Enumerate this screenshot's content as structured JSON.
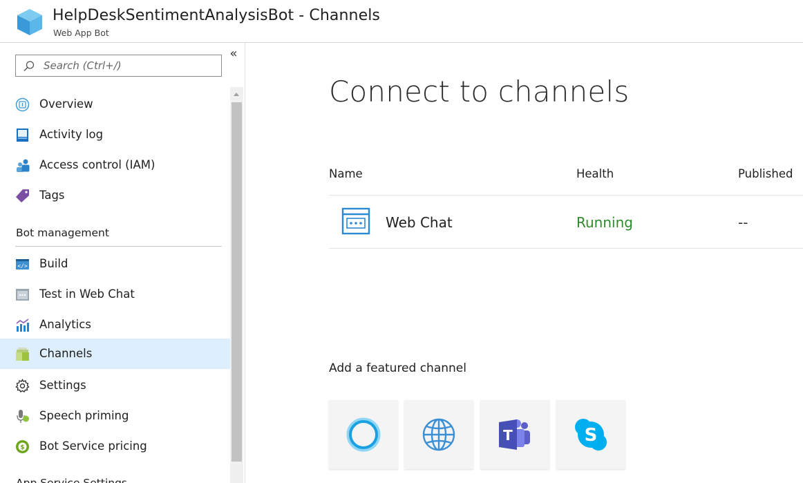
{
  "header": {
    "title": "HelpDeskSentimentAnalysisBot - Channels",
    "subtitle": "Web App Bot",
    "logo_icon": "cube-icon"
  },
  "sidebar": {
    "search_placeholder": "Search (Ctrl+/)",
    "collapse_glyph": "«",
    "items_top": [
      {
        "label": "Overview",
        "icon": "overview-icon"
      },
      {
        "label": "Activity log",
        "icon": "activity-log-icon"
      },
      {
        "label": "Access control (IAM)",
        "icon": "access-control-icon"
      },
      {
        "label": "Tags",
        "icon": "tag-icon"
      }
    ],
    "section_bot_management": "Bot management",
    "items_bot": [
      {
        "label": "Build",
        "icon": "build-icon"
      },
      {
        "label": "Test in Web Chat",
        "icon": "test-web-chat-icon"
      },
      {
        "label": "Analytics",
        "icon": "analytics-icon"
      },
      {
        "label": "Channels",
        "icon": "channels-icon",
        "active": true
      },
      {
        "label": "Settings",
        "icon": "gear-icon"
      },
      {
        "label": "Speech priming",
        "icon": "speech-priming-icon"
      },
      {
        "label": "Bot Service pricing",
        "icon": "pricing-icon"
      }
    ],
    "section_app_service": "App Service Settings"
  },
  "main": {
    "heading": "Connect to channels",
    "columns": {
      "name": "Name",
      "health": "Health",
      "published": "Published"
    },
    "channels": [
      {
        "name": "Web Chat",
        "health": "Running",
        "published": "--",
        "icon": "web-chat-icon"
      }
    ],
    "featured_heading": "Add a featured channel",
    "featured_tiles": [
      {
        "icon": "cortana-icon"
      },
      {
        "icon": "globe-icon"
      },
      {
        "icon": "teams-icon"
      },
      {
        "icon": "skype-icon"
      }
    ]
  },
  "colors": {
    "accent": "#0078d4",
    "active_bg": "#ddeefc",
    "running_green": "#2d8a2d"
  }
}
